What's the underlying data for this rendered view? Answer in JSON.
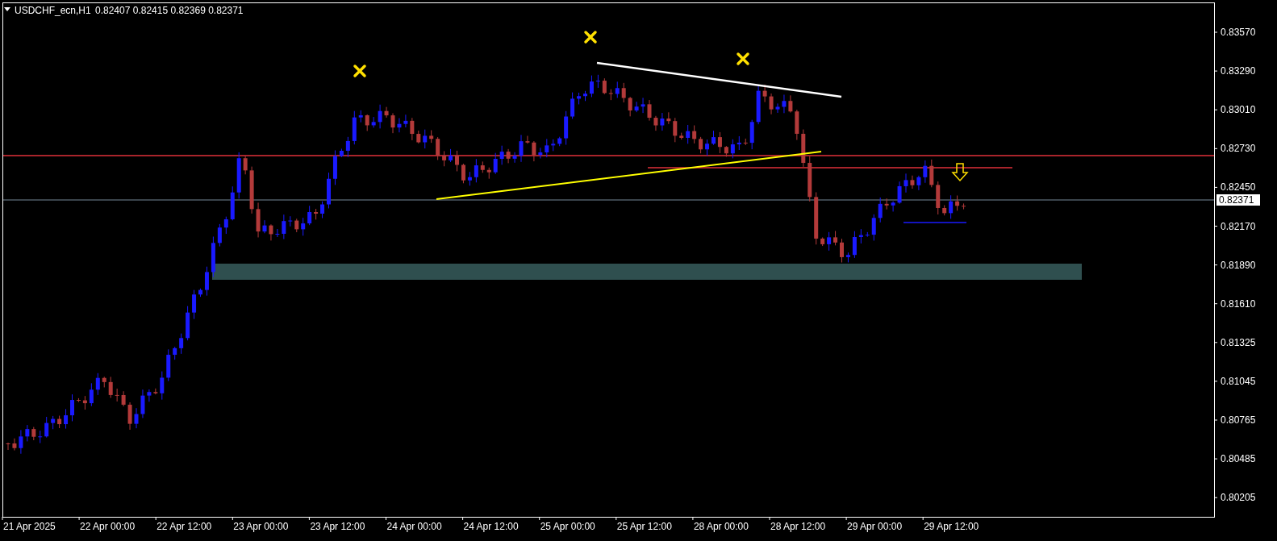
{
  "header": {
    "symbol": "USDCHF_ecn,H1",
    "prices": [
      "0.82407",
      "0.82415",
      "0.82369",
      "0.82371"
    ]
  },
  "price_axis": {
    "labels": [
      "0.83570",
      "0.83290",
      "0.83010",
      "0.82730",
      "0.82450",
      "0.82170",
      "0.81890",
      "0.81610",
      "0.81325",
      "0.81045",
      "0.80765",
      "0.80485",
      "0.80205"
    ],
    "current": "0.82371"
  },
  "time_axis": {
    "labels": [
      "21 Apr 2025",
      "22 Apr 00:00",
      "22 Apr 12:00",
      "23 Apr 00:00",
      "23 Apr 12:00",
      "24 Apr 00:00",
      "24 Apr 12:00",
      "25 Apr 00:00",
      "25 Apr 12:00",
      "28 Apr 00:00",
      "28 Apr 12:00",
      "29 Apr 00:00",
      "29 Apr 12:00"
    ]
  }
}
